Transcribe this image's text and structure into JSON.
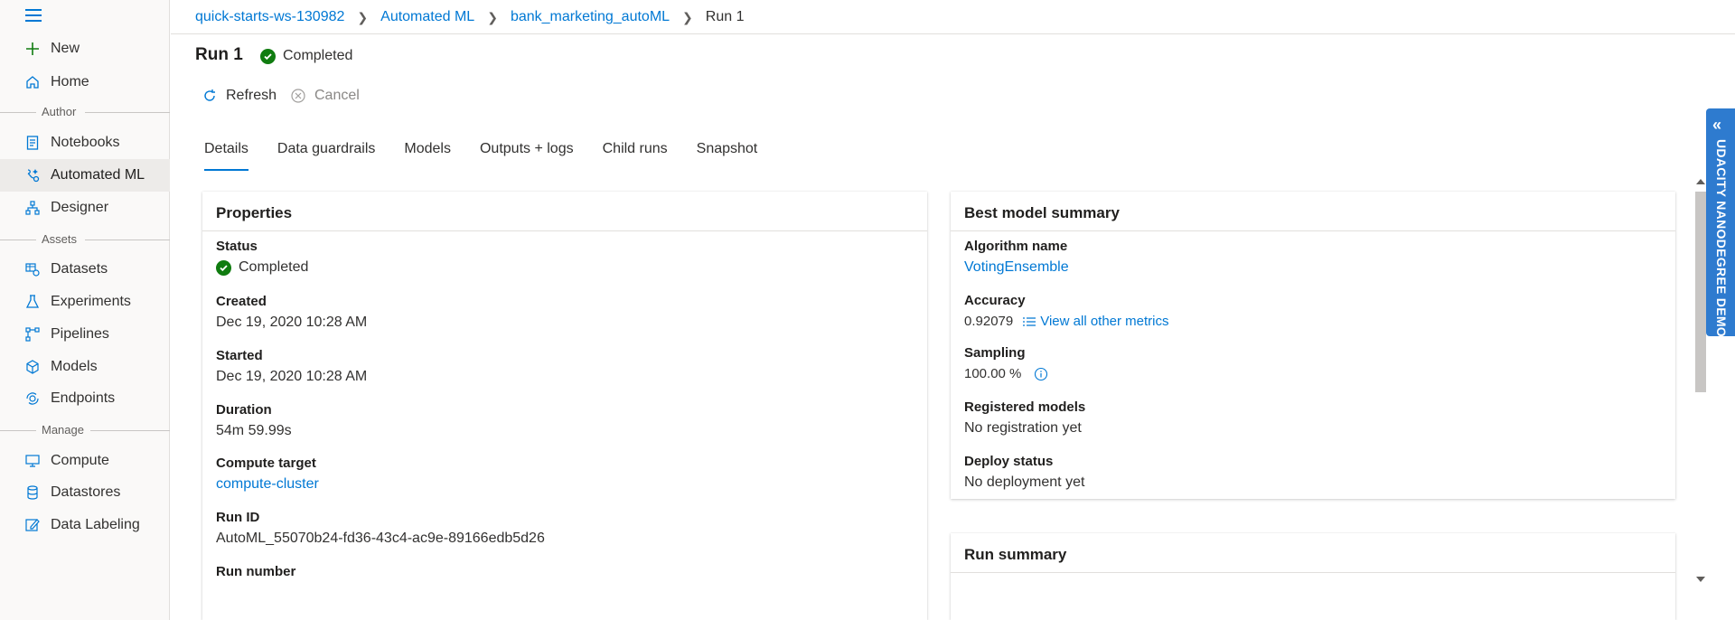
{
  "sidebar": {
    "items": [
      {
        "label": "New",
        "icon": "plus-icon"
      },
      {
        "label": "Home",
        "icon": "home-icon"
      },
      {
        "label": "Notebooks",
        "icon": "notebook-icon"
      },
      {
        "label": "Automated ML",
        "icon": "automated-ml-icon"
      },
      {
        "label": "Designer",
        "icon": "designer-icon"
      },
      {
        "label": "Datasets",
        "icon": "datasets-icon"
      },
      {
        "label": "Experiments",
        "icon": "flask-icon"
      },
      {
        "label": "Pipelines",
        "icon": "pipeline-icon"
      },
      {
        "label": "Models",
        "icon": "cube-icon"
      },
      {
        "label": "Endpoints",
        "icon": "endpoint-icon"
      },
      {
        "label": "Compute",
        "icon": "monitor-icon"
      },
      {
        "label": "Datastores",
        "icon": "database-icon"
      },
      {
        "label": "Data Labeling",
        "icon": "labeling-icon"
      }
    ],
    "sections": {
      "author": "Author",
      "assets": "Assets",
      "manage": "Manage"
    }
  },
  "breadcrumb": {
    "workspace": "quick-starts-ws-130982",
    "automl": "Automated ML",
    "experiment": "bank_marketing_autoML",
    "current": "Run 1"
  },
  "header": {
    "title": "Run 1",
    "status": "Completed"
  },
  "commands": {
    "refresh": "Refresh",
    "cancel": "Cancel"
  },
  "tabs": [
    "Details",
    "Data guardrails",
    "Models",
    "Outputs + logs",
    "Child runs",
    "Snapshot"
  ],
  "properties": {
    "title": "Properties",
    "status_label": "Status",
    "status_value": "Completed",
    "created_label": "Created",
    "created_value": "Dec 19, 2020 10:28 AM",
    "started_label": "Started",
    "started_value": "Dec 19, 2020 10:28 AM",
    "duration_label": "Duration",
    "duration_value": "54m 59.99s",
    "compute_label": "Compute target",
    "compute_value": "compute-cluster",
    "runid_label": "Run ID",
    "runid_value": "AutoML_55070b24-fd36-43c4-ac9e-89166edb5d26",
    "runnumber_label": "Run number"
  },
  "best_model": {
    "title": "Best model summary",
    "algorithm_label": "Algorithm name",
    "algorithm_value": "VotingEnsemble",
    "accuracy_label": "Accuracy",
    "accuracy_value": "0.92079",
    "metrics_link": "View all other metrics",
    "sampling_label": "Sampling",
    "sampling_value": "100.00 %",
    "registered_label": "Registered models",
    "registered_value": "No registration yet",
    "deploy_label": "Deploy status",
    "deploy_value": "No deployment yet"
  },
  "run_summary": {
    "title": "Run summary"
  },
  "side_tab": {
    "label": "UDACITY NANODEGREE DEMO"
  },
  "colors": {
    "accent": "#0078d4",
    "success": "#107c10",
    "side_tab": "#2e7bcf"
  }
}
